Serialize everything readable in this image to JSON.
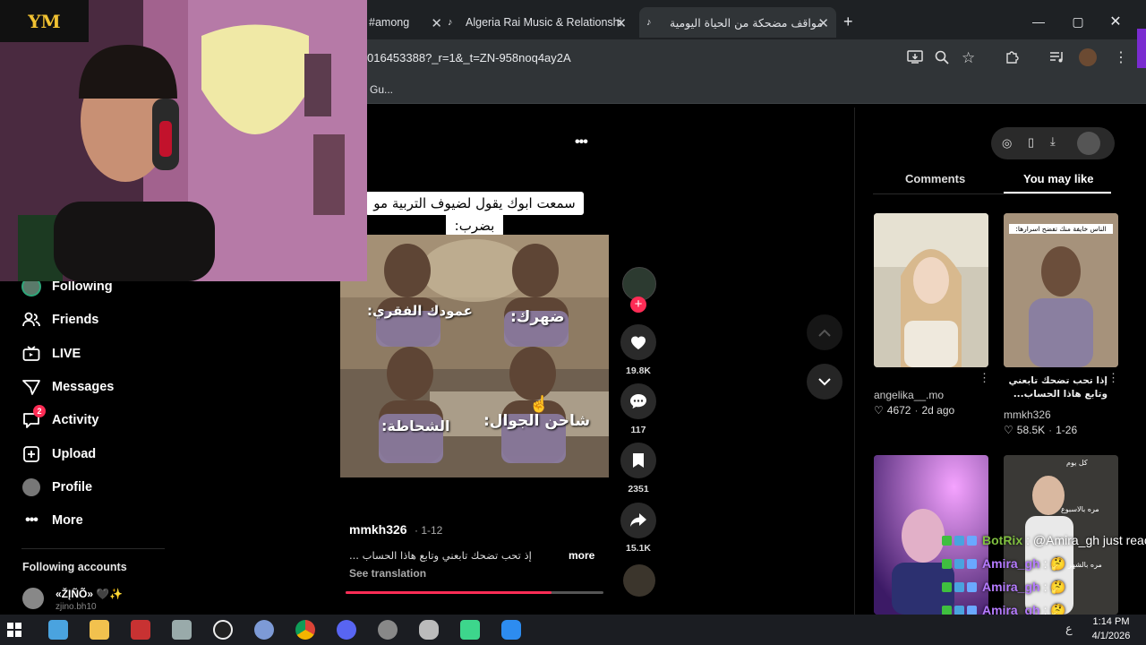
{
  "browser": {
    "tabs": [
      {
        "label": "#among"
      },
      {
        "label": "Algeria Rai Music & Relationshi"
      },
      {
        "label": "مواقف مضحكة من الحياة اليومية"
      }
    ],
    "new_tab": "+",
    "url": "016453388?_r=1&_t=ZN-958noq4ay2A",
    "bookmark": "Gu..."
  },
  "streamer": {
    "logo": "YM"
  },
  "sidebar": {
    "items": [
      {
        "label": "Following",
        "icon": "following-avatar-icon"
      },
      {
        "label": "Friends",
        "icon": "friends-icon"
      },
      {
        "label": "LIVE",
        "icon": "live-tv-icon"
      },
      {
        "label": "Messages",
        "icon": "messages-icon"
      },
      {
        "label": "Activity",
        "icon": "activity-icon",
        "badge": "2"
      },
      {
        "label": "Upload",
        "icon": "upload-icon"
      },
      {
        "label": "Profile",
        "icon": "profile-avatar-icon"
      },
      {
        "label": "More",
        "icon": "more-dots-icon"
      }
    ],
    "following_header": "Following accounts",
    "following_account": {
      "name": "«ŽĮÑÕ» 🖤✨",
      "handle": "zjino.bh10"
    }
  },
  "video": {
    "caption_line1": "سمعت ابوك يقول لضيوف التربية مو",
    "caption_line2": "بضرب:",
    "panel_labels": [
      "عمودك الفقري:",
      "ضهرك:",
      "الشحاطة:",
      "شاحن الجوال:"
    ],
    "author": "mmkh326",
    "date": "· 1-12",
    "description": "إذ تحب تضحك تابعني وتابع هاذا الحساب ...",
    "more_label": "more",
    "see_translation": "See translation",
    "progress": 0.8,
    "likes": "19.8K",
    "comments": "117",
    "saves": "2351",
    "shares": "15.1K"
  },
  "right_panel": {
    "tabs": {
      "comments": "Comments",
      "you_may_like": "You may like"
    },
    "cards": [
      {
        "username": "angelika__.mo",
        "likes": "4672",
        "date": "2d ago",
        "title": ""
      },
      {
        "username": "mmkh326",
        "likes": "58.5K",
        "date": "1-26",
        "title": "إذا تحب تضحك تابعني وتابع هاذا الحساب...",
        "overlay": "الناس خايفة منك تفضح اسرارها:"
      },
      {
        "username": "",
        "likes": "",
        "date": "",
        "title": ""
      },
      {
        "username": "",
        "likes": "",
        "date": "",
        "title": "",
        "overlay": "كل يوم",
        "overlay2": "مره بالاسبوع",
        "overlay3": "مره بالشهر"
      }
    ]
  },
  "chat": {
    "lines": [
      {
        "user": "BotRix",
        "message": ": @Amira_gh just reac",
        "color": "#7fbf3f"
      },
      {
        "user": "Amira_gh",
        "message": ": 🤔",
        "color": "#b57bff"
      },
      {
        "user": "Amira_gh",
        "message": ": 🤔",
        "color": "#b57bff"
      },
      {
        "user": "Amira_gh",
        "message": ": 🤔",
        "color": "#b57bff"
      },
      {
        "user": "Amira_gh",
        "message": ": 🤔",
        "color": "#b57bff"
      }
    ]
  },
  "taskbar": {
    "time": "1:14 PM",
    "date": "4/1/2026",
    "lang": "ع"
  },
  "colors": {
    "tiktok_red": "#fe2c55",
    "sidebar_bg": "#000000",
    "chrome_dark": "#1e2124"
  }
}
